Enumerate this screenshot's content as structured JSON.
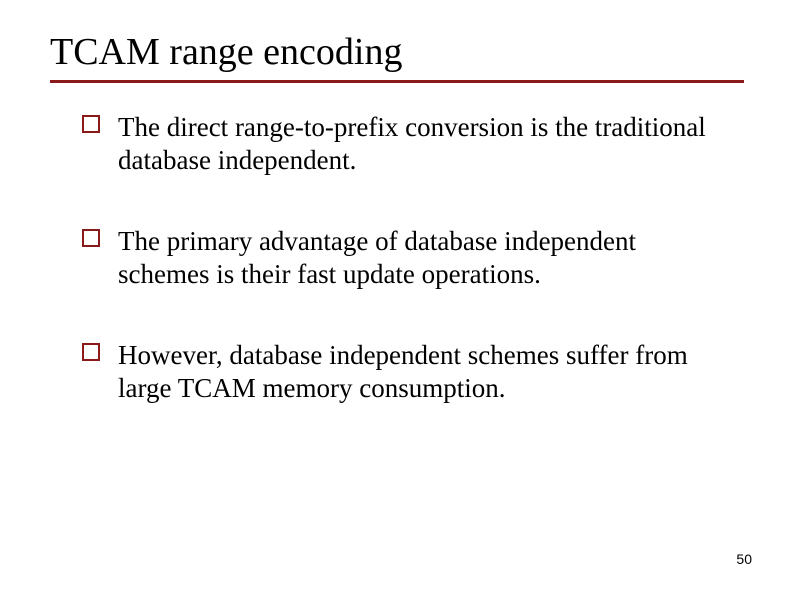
{
  "slide": {
    "title": "TCAM range encoding",
    "bullets": [
      "The direct range-to-prefix conversion is the traditional database independent.",
      "The primary advantage of database independent schemes is their fast update operations.",
      "However, database independent  schemes suffer from large TCAM memory consumption."
    ],
    "page_number": "50"
  },
  "colors": {
    "accent": "#8a1a1a"
  }
}
